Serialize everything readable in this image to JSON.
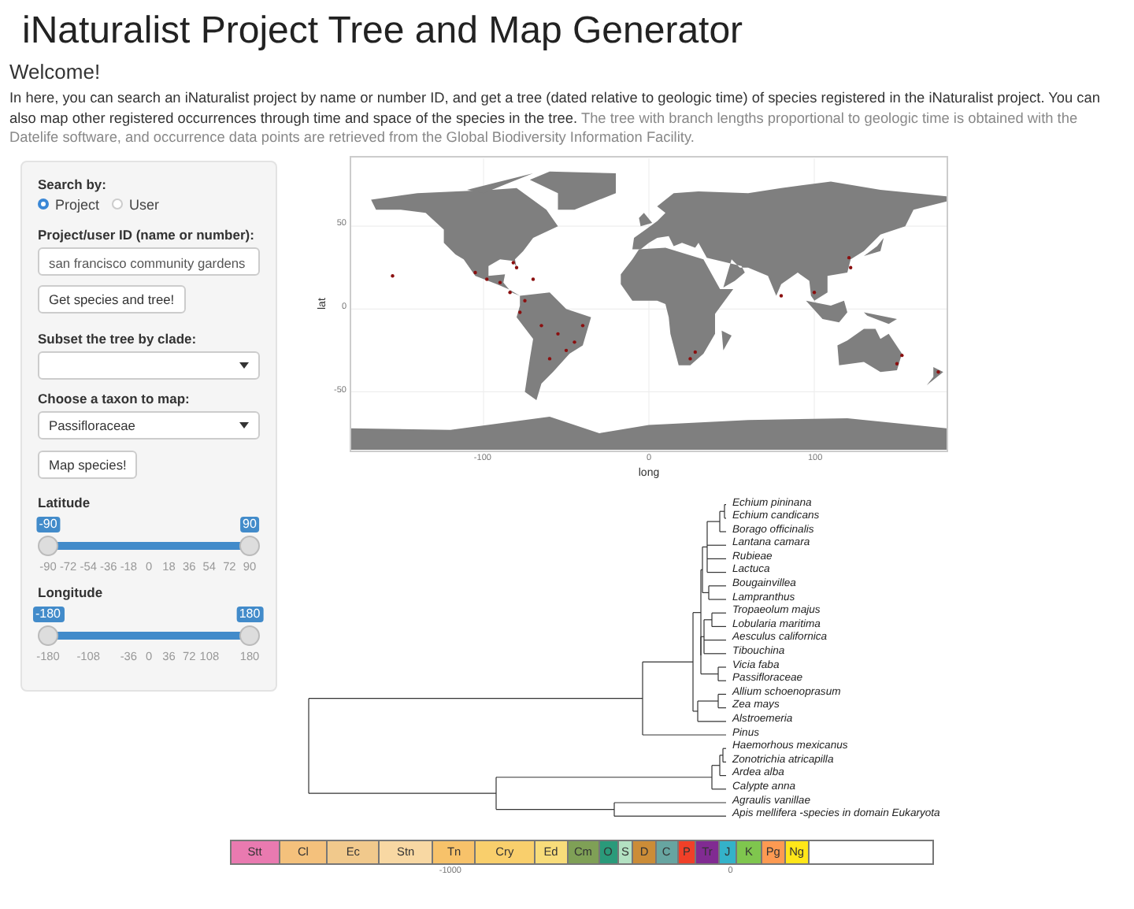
{
  "title": "iNaturalist Project Tree and Map Generator",
  "welcome": "Welcome!",
  "intro": {
    "text": "In here, you can search an iNaturalist project by name or number ID, and get a tree (dated relative to geologic time) of species registered in the iNaturalist project. You can also map other registered occurrences through time and space of the species in the tree.",
    "note": "The tree with branch lengths proportional to geologic time is obtained with the Datelife software, and occurrence data points are retrieved from the Global Biodiversity Information Facility."
  },
  "sidebar": {
    "search_by": {
      "label": "Search by:",
      "options": [
        {
          "label": "Project",
          "selected": true
        },
        {
          "label": "User",
          "selected": false
        }
      ]
    },
    "id_field": {
      "label": "Project/user ID (name or number):",
      "value": "san francisco community gardens"
    },
    "get_button": "Get species and tree!",
    "clade_select": {
      "label": "Subset the tree by clade:"
    },
    "taxon_select": {
      "label": "Choose a taxon to map:",
      "value": "Passifloraceae"
    },
    "map_button": "Map species!",
    "sliders": [
      {
        "label": "Latitude",
        "from": "-90",
        "to": "90",
        "ticks": [
          "-90",
          "-72",
          "-54",
          "-36",
          "-18",
          "0",
          "18",
          "36",
          "54",
          "72",
          "90"
        ]
      },
      {
        "label": "Longitude",
        "from": "-180",
        "to": "180",
        "ticks": [
          "-180",
          "-108",
          "-36",
          "0",
          "36",
          "72",
          "108",
          "180"
        ]
      }
    ]
  },
  "map": {
    "ylabel": "lat",
    "yticks": [
      "50",
      "0",
      "-50"
    ],
    "xticks": [
      "-100",
      "0",
      "100"
    ],
    "xlabel": "long"
  },
  "tree": {
    "tips": [
      "Echium pininana",
      "Echium candicans",
      "Borago officinalis",
      "Lantana camara",
      "Rubieae",
      "Lactuca",
      "Bougainvillea",
      "Lampranthus",
      "Tropaeolum majus",
      "Lobularia maritima",
      "Aesculus californica",
      "Tibouchina",
      "Vicia faba",
      "Passifloraceae",
      "Allium schoenoprasum",
      "Zea mays",
      "Alstroemeria",
      "Pinus",
      "Haemorhous mexicanus",
      "Zonotrichia atricapilla",
      "Ardea alba",
      "Calypte anna",
      "Agraulis vanillae",
      "Apis mellifera -species in domain Eukaryota"
    ]
  },
  "timescale": {
    "periods": [
      {
        "label": "Stt",
        "color": "#e97ab0"
      },
      {
        "label": "Cl",
        "color": "#f4c17c"
      },
      {
        "label": "Ec",
        "color": "#f1c98c"
      },
      {
        "label": "Stn",
        "color": "#f8d8a3"
      },
      {
        "label": "Tn",
        "color": "#f7c26a"
      },
      {
        "label": "Cry",
        "color": "#f9cf6c"
      },
      {
        "label": "Ed",
        "color": "#f8dc7a"
      },
      {
        "label": "Cm",
        "color": "#7fa056"
      },
      {
        "label": "O",
        "color": "#2a9a7a"
      },
      {
        "label": "S",
        "color": "#b3e1c2"
      },
      {
        "label": "D",
        "color": "#cb8c37"
      },
      {
        "label": "C",
        "color": "#67a5a1"
      },
      {
        "label": "P",
        "color": "#f04028"
      },
      {
        "label": "Tr",
        "color": "#812b92"
      },
      {
        "label": "J",
        "color": "#34b2c9"
      },
      {
        "label": "K",
        "color": "#7fc64e"
      },
      {
        "label": "Pg",
        "color": "#fd9a52"
      },
      {
        "label": "Ng",
        "color": "#ffe619"
      }
    ],
    "ticks": [
      "-1000",
      "0"
    ]
  }
}
